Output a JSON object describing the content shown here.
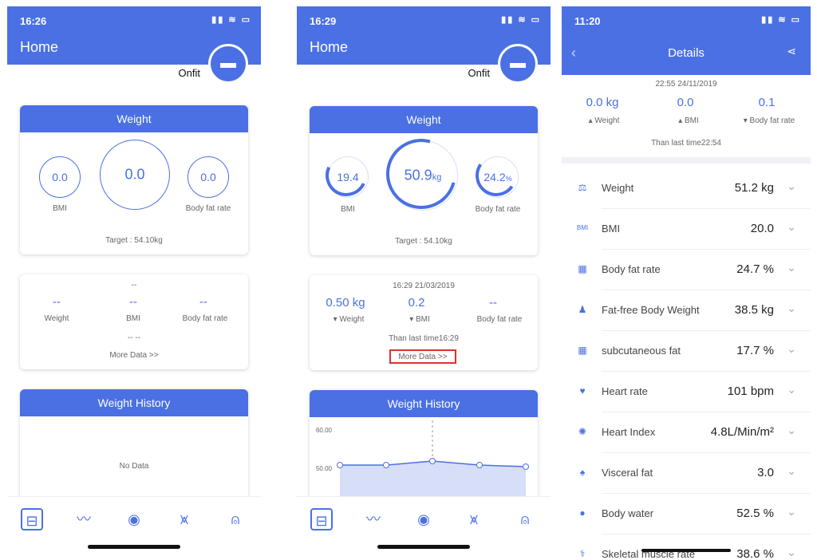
{
  "screen1": {
    "time": "16:26",
    "title": "Home",
    "brand": "Onfit",
    "weight_card": {
      "title": "Weight",
      "bmi": "0.0",
      "weight": "0.0",
      "fat": "0.0",
      "bmi_label": "BMI",
      "fat_label": "Body fat rate",
      "target": "Target : 54.10kg"
    },
    "data_card": {
      "date": "--",
      "weight_val": "--",
      "bmi_val": "--",
      "fat_val": "--",
      "weight_label": "Weight",
      "bmi_label": "BMI",
      "fat_label": "Body fat rate",
      "compare": "-- --",
      "more": "More Data >>"
    },
    "history": {
      "title": "Weight History",
      "empty": "No Data"
    }
  },
  "screen2": {
    "time": "16:29",
    "title": "Home",
    "brand": "Onfit",
    "weight_card": {
      "title": "Weight",
      "bmi": "19.4",
      "weight": "50.9",
      "weight_unit": "kg",
      "fat": "24.2",
      "fat_unit": "%",
      "bmi_label": "BMI",
      "fat_label": "Body fat rate",
      "target": "Target : 54.10kg",
      "bmi_progress": 0.3,
      "weight_progress": 0.6,
      "fat_progress": 0.4
    },
    "data_card": {
      "date": "16:29 21/03/2019",
      "weight_val": "0.50 kg",
      "bmi_val": "0.2",
      "fat_val": "--",
      "weight_label": "Weight",
      "bmi_label": "BMI",
      "fat_label": "Body fat rate",
      "compare": "Than last time16:29",
      "more": "More Data >>"
    },
    "history": {
      "title": "Weight History",
      "y_top": "60.00",
      "y_mid": "50.00"
    }
  },
  "screen3": {
    "time": "11:20",
    "title": "Details",
    "date": "22:55 24/11/2019",
    "summary": [
      {
        "value": "0.0 kg",
        "label": "Weight"
      },
      {
        "value": "0.0",
        "label": "BMI"
      },
      {
        "value": "0.1",
        "label": "Body fat rate"
      }
    ],
    "compare": "Than last time22:54",
    "rows": [
      {
        "icon": "scale-icon",
        "label": "Weight",
        "value": "51.2 kg"
      },
      {
        "icon": "bmi-icon",
        "label": "BMI",
        "value": "20.0"
      },
      {
        "icon": "fat-grid-icon",
        "label": "Body fat rate",
        "value": "24.7 %"
      },
      {
        "icon": "person-icon",
        "label": "Fat-free Body Weight",
        "value": "38.5 kg"
      },
      {
        "icon": "fat-grid-icon",
        "label": "subcutaneous fat",
        "value": "17.7 %"
      },
      {
        "icon": "heart-icon",
        "label": "Heart rate",
        "value": "101 bpm"
      },
      {
        "icon": "heart-index-icon",
        "label": "Heart Index",
        "value": "4.8L/Min/m²"
      },
      {
        "icon": "lungs-icon",
        "label": "Visceral fat",
        "value": "3.0"
      },
      {
        "icon": "water-drop-icon",
        "label": "Body water",
        "value": "52.5 %"
      },
      {
        "icon": "skeleton-icon",
        "label": "Skeletal muscle rate",
        "value": "38.6 %"
      }
    ]
  },
  "colors": {
    "accent": "#4a70e3",
    "background": "#ffffff"
  }
}
